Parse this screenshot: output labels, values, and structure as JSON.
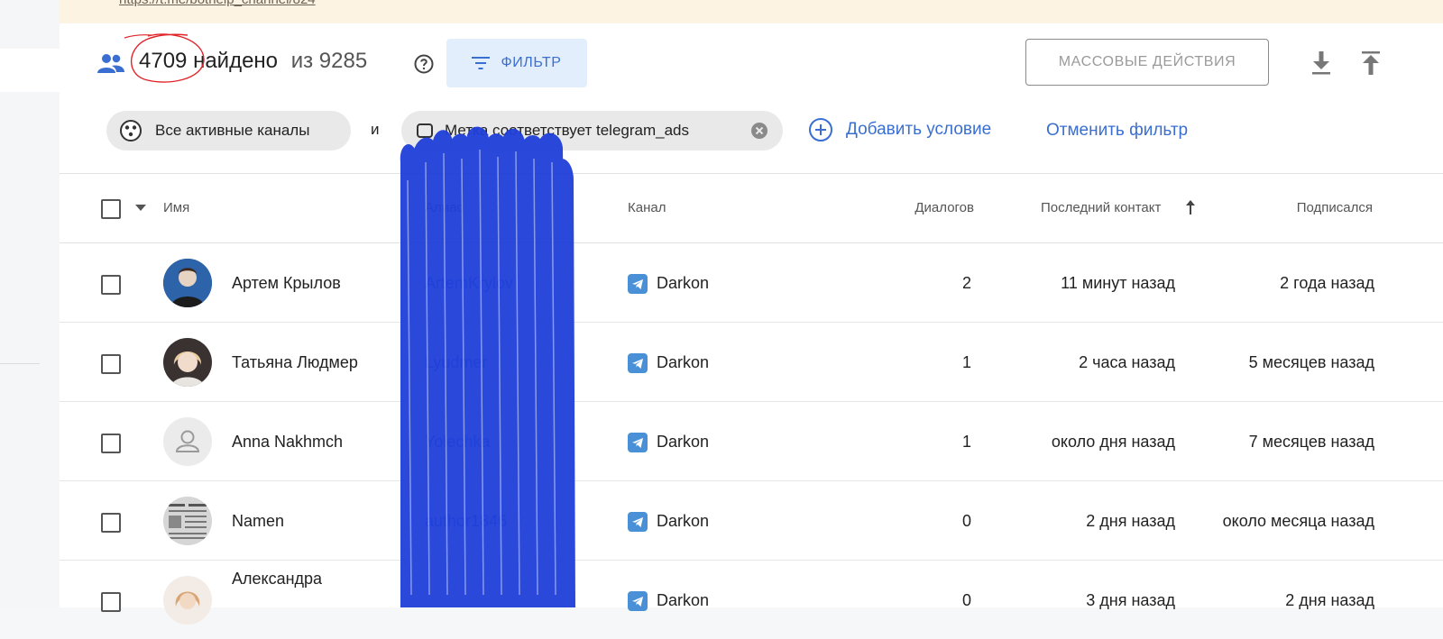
{
  "banner": {
    "url": "https://t.me/bothelp_channel/824"
  },
  "header": {
    "count": "4709",
    "found_label": "найдено",
    "total_label": "из 9285",
    "filter_button": "ФИЛЬТР",
    "mass_actions_button": "МАССОВЫЕ ДЕЙСТВИЯ"
  },
  "filters": {
    "channel_chip": "Все активные каналы",
    "and_word": "и",
    "tag_chip": "Метка соответствует telegram_ads",
    "add_condition": "Добавить условие",
    "cancel_filter": "Отменить фильтр"
  },
  "table": {
    "columns": {
      "name": "Имя",
      "alias": "Алиас",
      "channel": "Канал",
      "dialogs": "Диалогов",
      "last_contact": "Последний контакт",
      "subscribed": "Подписался"
    },
    "rows": [
      {
        "name": "Артем Крылов",
        "alias": "ArtemKrylov",
        "channel": "Darkon",
        "dialogs": "2",
        "last_contact": "11 минут назад",
        "subscribed": "2 года назад"
      },
      {
        "name": "Татьяна Людмер",
        "alias": "Lyudmer",
        "channel": "Darkon",
        "dialogs": "1",
        "last_contact": "2 часа назад",
        "subscribed": "5 месяцев назад"
      },
      {
        "name": "Anna Nakhmch",
        "alias": "Yolechka",
        "channel": "Darkon",
        "dialogs": "1",
        "last_contact": "около дня назад",
        "subscribed": "7 месяцев назад"
      },
      {
        "name": "Namen",
        "alias": "author1846",
        "channel": "Darkon",
        "dialogs": "0",
        "last_contact": "2 дня назад",
        "subscribed": "около месяца назад"
      },
      {
        "name": "Александра",
        "alias": "",
        "channel": "Darkon",
        "dialogs": "0",
        "last_contact": "3 дня назад",
        "subscribed": "2 дня назад"
      }
    ]
  },
  "colors": {
    "accent": "#3a6fd1",
    "filter_bg": "#e3eefc",
    "banner_bg": "#fdf3e3",
    "scribble": "#1f3fd9",
    "annotation": "#e0242a"
  }
}
